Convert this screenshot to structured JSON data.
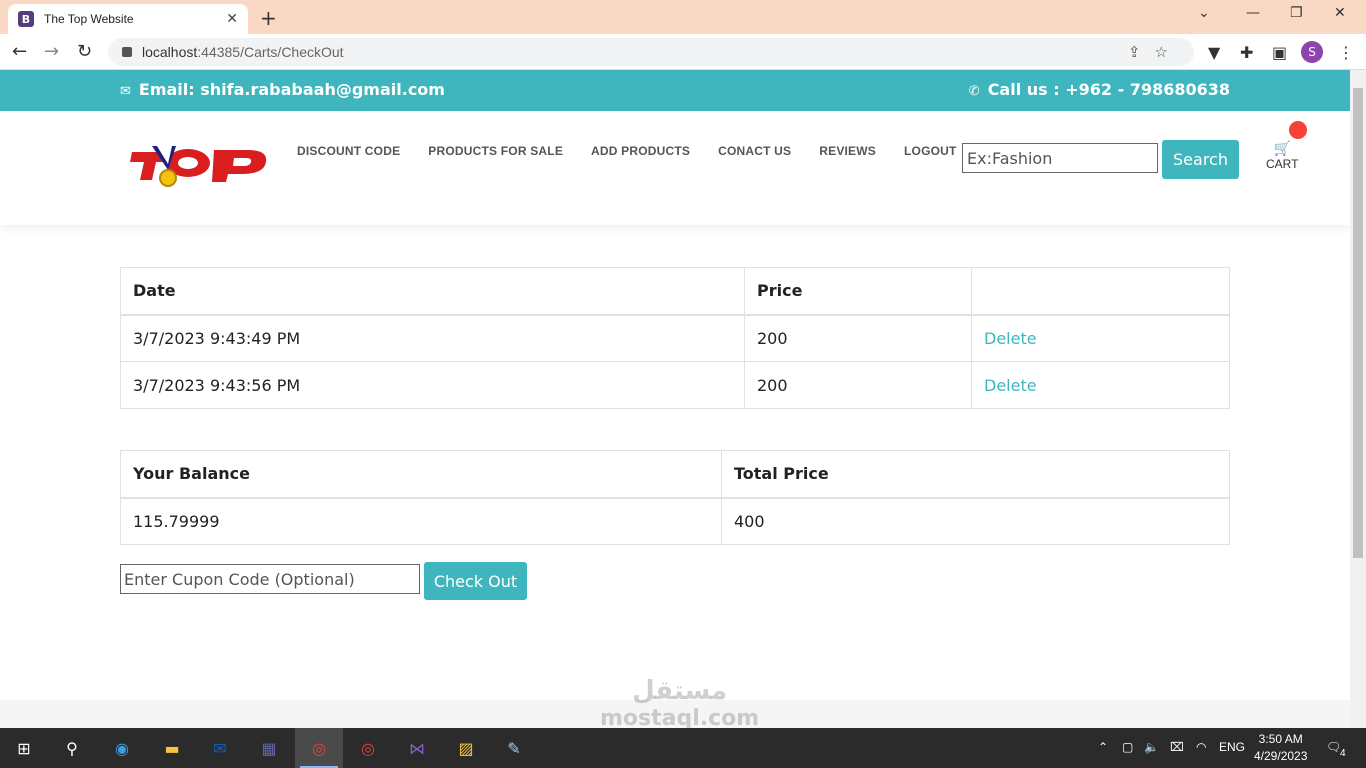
{
  "browser": {
    "tab_title": "The Top Website",
    "tab_favicon": "B",
    "url_host": "localhost",
    "url_rest": ":44385/Carts/CheckOut",
    "profile_initial": "S"
  },
  "topbar": {
    "email": "Email: shifa.rababaah@gmail.com",
    "call": "Call us : +962 - 798680638"
  },
  "header": {
    "nav": [
      "DISCOUNT CODE",
      "PRODUCTS FOR SALE",
      "ADD PRODUCTS",
      "CONACT US",
      "REVIEWS",
      "LOGOUT"
    ],
    "search_placeholder": "Ex:Fashion",
    "search_label": "Search",
    "cart_label": "CART"
  },
  "orders_table": {
    "headers": [
      "Date",
      "Price",
      ""
    ],
    "rows": [
      {
        "date": "3/7/2023 9:43:49 PM",
        "price": "200",
        "action": "Delete"
      },
      {
        "date": "3/7/2023 9:43:56 PM",
        "price": "200",
        "action": "Delete"
      }
    ]
  },
  "summary_table": {
    "headers": [
      "Your Balance",
      "Total Price"
    ],
    "balance": "115.79999",
    "total": "400"
  },
  "checkout": {
    "cupon_placeholder": "Enter Cupon Code (Optional)",
    "button_label": "Check Out"
  },
  "watermark": {
    "arabic": "مستقل",
    "latin": "mostaql.com"
  },
  "taskbar": {
    "lang": "ENG",
    "time": "3:50 AM",
    "date": "4/29/2023",
    "notifications": "4"
  },
  "colors": {
    "accent": "#3fb6bd",
    "cart_badge": "#f44336"
  }
}
